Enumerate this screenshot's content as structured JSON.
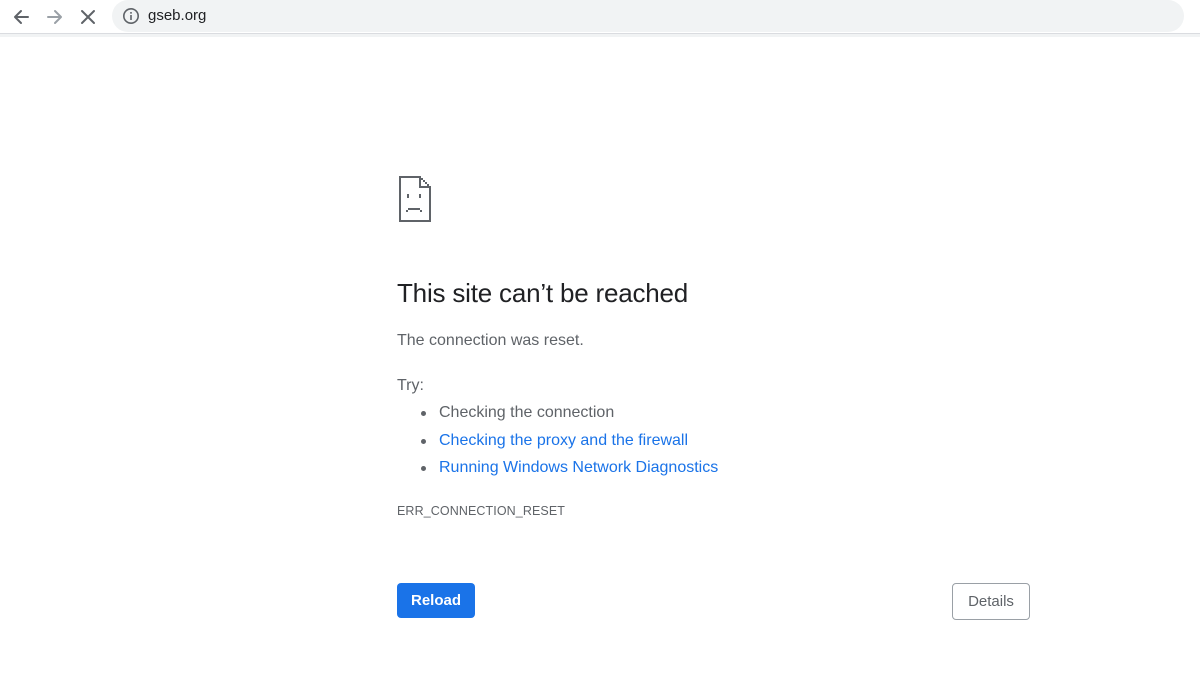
{
  "browser": {
    "url": "gseb.org",
    "icons": {
      "back": "arrow-left-icon",
      "forward": "arrow-right-icon",
      "stop": "close-icon",
      "site_info": "info-icon"
    }
  },
  "error_page": {
    "icon": "sad-document-icon",
    "title": "This site can’t be reached",
    "subtitle": "The connection was reset.",
    "try_label": "Try:",
    "suggestions": [
      {
        "text": "Checking the connection",
        "link": false
      },
      {
        "text": "Checking the proxy and the firewall",
        "link": true
      },
      {
        "text": "Running Windows Network Diagnostics",
        "link": true
      }
    ],
    "error_code": "ERR_CONNECTION_RESET",
    "reload_label": "Reload",
    "details_label": "Details"
  },
  "colors": {
    "accent": "#1a73e8",
    "text_primary": "#202124",
    "text_secondary": "#5f6368",
    "omnibox_bg": "#f1f3f4"
  }
}
